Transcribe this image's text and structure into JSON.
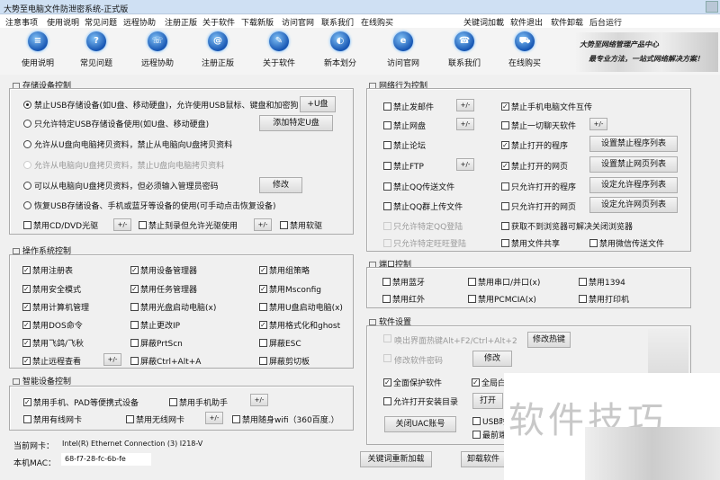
{
  "title": "大势至电脑文件防泄密系统-正式版",
  "menu": [
    "注意事项",
    "使用说明",
    "常见问题",
    "远程协助",
    "注册正版",
    "关于软件",
    "下载新版",
    "访问官网",
    "联系我们",
    "在线购买"
  ],
  "menu_right": [
    "关键词加載",
    "软件退出",
    "软件卸载",
    "后台运行"
  ],
  "toolbar": [
    {
      "label": "使用说明",
      "icon": "manual-icon",
      "g": "≡"
    },
    {
      "label": "常见问题",
      "icon": "question-icon",
      "g": "?"
    },
    {
      "label": "远程协助",
      "icon": "remote-assist-icon",
      "g": "☏"
    },
    {
      "label": "注册正版",
      "icon": "register-icon",
      "g": "@"
    },
    {
      "label": "关于软件",
      "icon": "about-icon",
      "g": "✎"
    },
    {
      "label": "新本划分",
      "icon": "version-icon",
      "g": "◐"
    },
    {
      "label": "访问官网",
      "icon": "website-icon",
      "g": "e"
    },
    {
      "label": "联系我们",
      "icon": "contact-icon",
      "g": "☎"
    },
    {
      "label": "在线购买",
      "icon": "cart-icon",
      "g": "⛟"
    }
  ],
  "banner": [
    "大势至网络管理产品中心",
    "最专业方法，一站式网络解决方案！"
  ],
  "storage": {
    "title": "存储设备控制",
    "radios": [
      {
        "label": "禁止USB存储设备(如U盘、移动硬盘)，允许使用USB鼠标、键盘和加密狗",
        "checked": true
      },
      {
        "label": "只允许特定USB存储设备使用(如U盘、移动硬盘)",
        "checked": false
      },
      {
        "label": "允许从U盘向电脑拷贝资料，禁止从电脑向U盘拷贝资料",
        "checked": false
      },
      {
        "label": "允许从电脑向U盘拷贝资料，禁止U盘向电脑拷贝资料",
        "checked": false,
        "disabled": true
      },
      {
        "label": "可以从电脑向U盘拷贝资料，但必须输入管理员密码",
        "checked": false
      },
      {
        "label": "恢复USB存储设备、手机或蓝牙等设备的使用(可手动点击恢复设备)",
        "checked": false
      }
    ],
    "btn_plus_udisk": "+U盘",
    "btn_add_udisk": "添加特定U盘",
    "btn_modify": "修改",
    "checks": [
      {
        "label": "禁用CD/DVD光驱",
        "checked": false
      },
      {
        "label": "禁止刻录但允许光驱使用",
        "checked": false
      },
      {
        "label": "禁用软驱",
        "checked": false
      }
    ],
    "pm": "+/-"
  },
  "os": {
    "title": "操作系统控制",
    "items": [
      {
        "label": "禁用注册表",
        "checked": true
      },
      {
        "label": "禁用设备管理器",
        "checked": true
      },
      {
        "label": "禁用组策略",
        "checked": true
      },
      {
        "label": "禁用安全模式",
        "checked": true
      },
      {
        "label": "禁用任务管理器",
        "checked": true
      },
      {
        "label": "禁用Msconfig",
        "checked": true
      },
      {
        "label": "禁用计算机管理",
        "checked": true
      },
      {
        "label": "禁用光盘启动电脑(x)",
        "checked": false
      },
      {
        "label": "禁用U盘启动电脑(x)",
        "checked": false
      },
      {
        "label": "禁用DOS命令",
        "checked": true
      },
      {
        "label": "禁止更改IP",
        "checked": false
      },
      {
        "label": "禁用格式化和ghost",
        "checked": true
      },
      {
        "label": "禁用飞鸽/飞秋",
        "checked": true
      },
      {
        "label": "屏蔽PrtScn",
        "checked": false
      },
      {
        "label": "屏蔽ESC",
        "checked": false
      },
      {
        "label": "禁止远程查看",
        "checked": true
      },
      {
        "label": "屏蔽Ctrl+Alt+A",
        "checked": false
      },
      {
        "label": "屏蔽剪切板",
        "checked": false
      }
    ]
  },
  "smart": {
    "title": "智能设备控制",
    "items": [
      {
        "label": "禁用手机、PAD等便携式设备",
        "checked": true
      },
      {
        "label": "禁用手机助手",
        "checked": false
      },
      {
        "label": "禁用有线网卡",
        "checked": false
      },
      {
        "label": "禁用无线网卡",
        "checked": false
      },
      {
        "label": "禁用随身wifi（360百度.）",
        "checked": false
      }
    ]
  },
  "nic": {
    "label": "当前网卡：",
    "value": "Intel(R) Ethernet Connection (3) I218-V",
    "mac_label": "本机MAC：",
    "mac": "68-f7-28-fc-6b-fe"
  },
  "network": {
    "title": "网络行为控制",
    "left": [
      {
        "label": "禁止发邮件",
        "checked": false
      },
      {
        "label": "禁止网盘",
        "checked": false
      },
      {
        "label": "禁止论坛",
        "checked": false
      },
      {
        "label": "禁止FTP",
        "checked": false
      },
      {
        "label": "禁止QQ传送文件",
        "checked": false
      },
      {
        "label": "禁止QQ群上传文件",
        "checked": false
      },
      {
        "label": "只允许特定QQ登陆",
        "checked": false,
        "disabled": true
      },
      {
        "label": "只允许特定旺旺登陆",
        "checked": false,
        "disabled": true
      }
    ],
    "right": [
      {
        "label": "禁止手机电脑文件互传",
        "checked": true
      },
      {
        "label": "禁止一切聊天软件",
        "checked": false
      },
      {
        "label": "禁止打开的程序",
        "checked": true
      },
      {
        "label": "禁止打开的网页",
        "checked": true
      },
      {
        "label": "只允许打开的程序",
        "checked": false
      },
      {
        "label": "只允许打开的网页",
        "checked": false
      },
      {
        "label": "获取不到浏览器可解决关闭浏览器",
        "checked": false
      },
      {
        "label": "禁用文件共享",
        "checked": false
      }
    ],
    "extra": {
      "label": "禁用微信传送文件",
      "checked": false
    },
    "buttons": [
      "设置禁止程序列表",
      "设置禁止网页列表",
      "设定允许程序列表",
      "设定允许网页列表"
    ]
  },
  "port": {
    "title": "端口控制",
    "items": [
      {
        "label": "禁用蓝牙",
        "checked": false
      },
      {
        "label": "禁用串口/并口(x)",
        "checked": false
      },
      {
        "label": "禁用1394",
        "checked": false
      },
      {
        "label": "禁用红外",
        "checked": false
      },
      {
        "label": "禁用PCMCIA(x)",
        "checked": false
      },
      {
        "label": "禁用打印机",
        "checked": false
      }
    ]
  },
  "settings": {
    "title": "软件设置",
    "hotkey": "唤出界面热键Alt+F2/Ctrl+Alt+2",
    "hotkey_btn": "修改热键",
    "password": "修改软件密码",
    "password_btn": "修改",
    "protect": {
      "label": "全面保护软件",
      "checked": true
    },
    "autostart": {
      "label": "全局白",
      "checked": true
    },
    "allow_dir": {
      "label": "允许打开安装目录",
      "checked": false
    },
    "open_btn": "打开",
    "uac_btn": "关闭UAC账号",
    "usb": {
      "label": "USB时",
      "checked": false
    },
    "latest": {
      "label": "最前端",
      "checked": false
    }
  },
  "bottom": {
    "reload": "关键词重新加载",
    "uninstall": "卸载软件"
  },
  "watermark": "软件技巧"
}
